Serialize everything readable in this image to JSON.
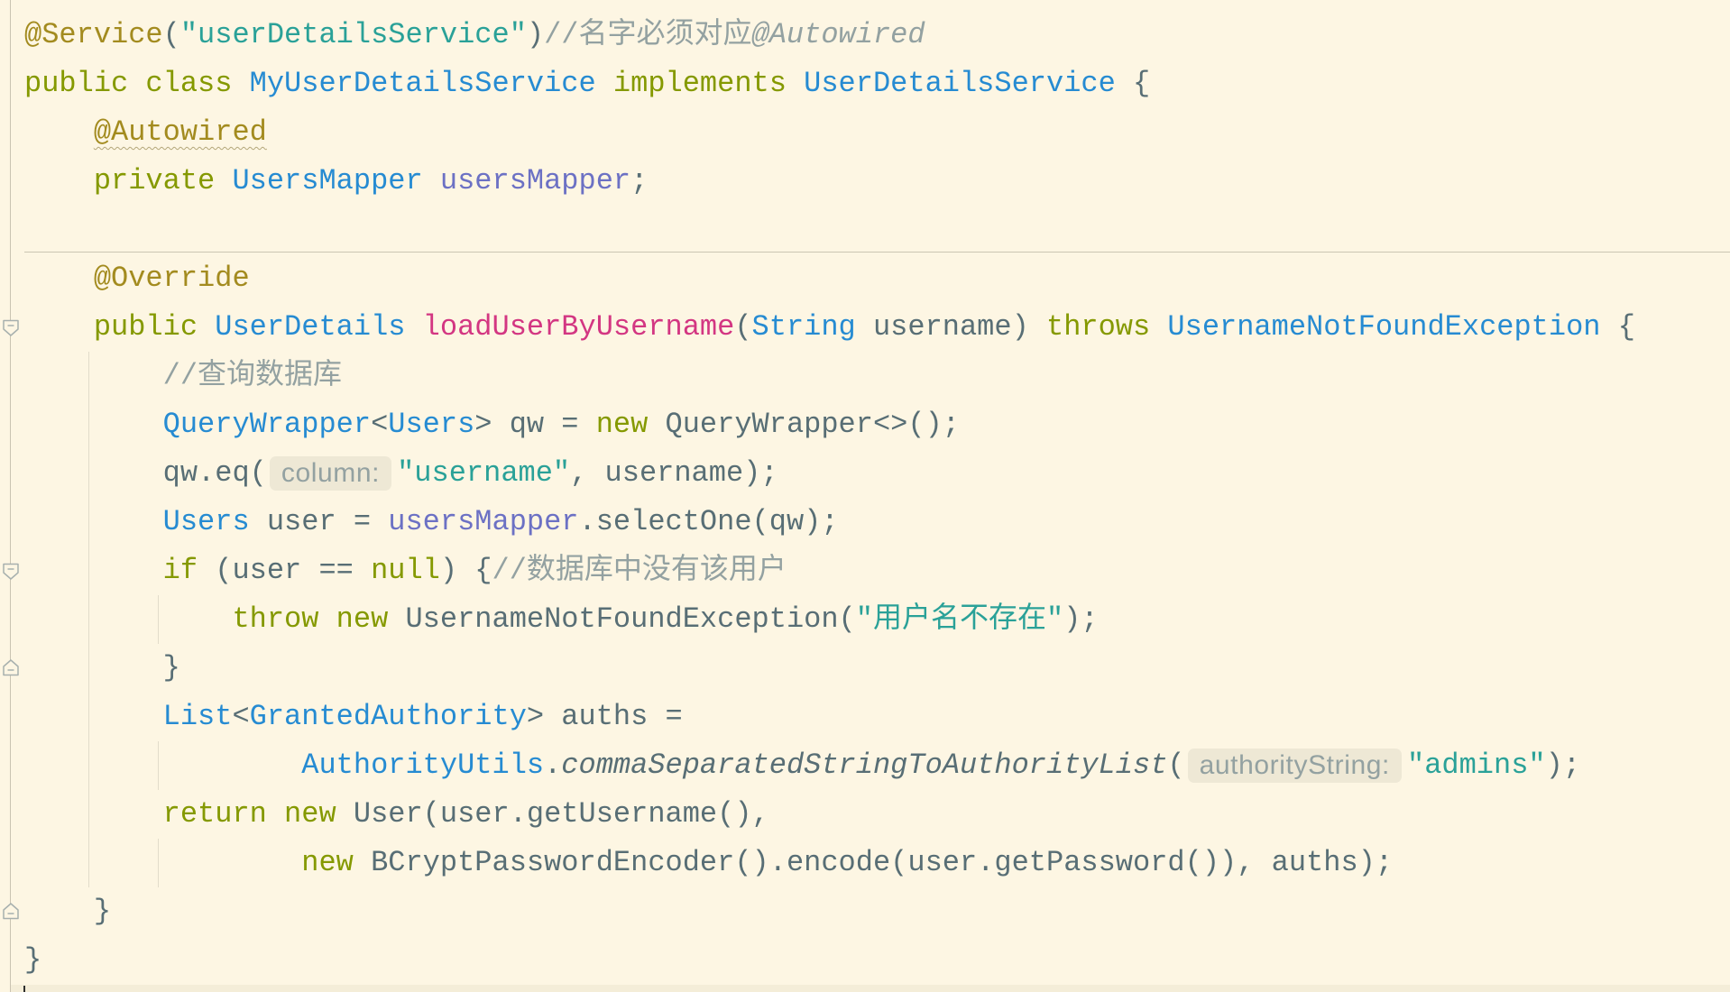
{
  "theme": {
    "background": "#FDF6E3",
    "text": "#586E75",
    "keyword": "#859900",
    "annotation": "#A38B1F",
    "string": "#2AA198",
    "comment": "#93A1A1",
    "type": "#268BD2",
    "field": "#6C71C4",
    "method": "#D33682",
    "hint_background": "#EEE8D5",
    "hint_text": "#93A1A1",
    "warning_underline": "#B3A77A"
  },
  "editor": {
    "lines": [
      {
        "tokens": [
          {
            "t": "@Service",
            "k": "annotation"
          },
          {
            "t": "(",
            "k": "text"
          },
          {
            "t": "\"userDetailsService\"",
            "k": "string"
          },
          {
            "t": ")",
            "k": "text"
          },
          {
            "t": "//名字必须对应",
            "k": "comment"
          },
          {
            "t": "@Autowired",
            "k": "comment-tag"
          }
        ]
      },
      {
        "tokens": [
          {
            "t": "public class ",
            "k": "keyword"
          },
          {
            "t": "MyUserDetailsService",
            "k": "type"
          },
          {
            "t": " implements ",
            "k": "keyword"
          },
          {
            "t": "UserDetailsService",
            "k": "type"
          },
          {
            "t": " {",
            "k": "text"
          }
        ]
      },
      {
        "tokens": [
          {
            "t": "    ",
            "k": "text"
          },
          {
            "t": "@Autowired",
            "k": "annotation-warning"
          }
        ]
      },
      {
        "tokens": [
          {
            "t": "    ",
            "k": "text"
          },
          {
            "t": "private ",
            "k": "keyword"
          },
          {
            "t": "UsersMapper",
            "k": "type"
          },
          {
            "t": " ",
            "k": "text"
          },
          {
            "t": "usersMapper",
            "k": "field"
          },
          {
            "t": ";",
            "k": "text"
          }
        ]
      },
      {
        "tokens": []
      },
      {
        "tokens": [
          {
            "t": "    ",
            "k": "text"
          },
          {
            "t": "@Override",
            "k": "annotation"
          }
        ]
      },
      {
        "gutter_icon": "fold-start-icon",
        "tokens": [
          {
            "t": "    ",
            "k": "text"
          },
          {
            "t": "public ",
            "k": "keyword"
          },
          {
            "t": "UserDetails",
            "k": "type"
          },
          {
            "t": " ",
            "k": "text"
          },
          {
            "t": "loadUserByUsername",
            "k": "method"
          },
          {
            "t": "(",
            "k": "text"
          },
          {
            "t": "String",
            "k": "type"
          },
          {
            "t": " username) ",
            "k": "text"
          },
          {
            "t": "throws ",
            "k": "keyword"
          },
          {
            "t": "UsernameNotFoundException",
            "k": "type"
          },
          {
            "t": " {",
            "k": "text"
          }
        ]
      },
      {
        "tokens": [
          {
            "t": "        ",
            "k": "text"
          },
          {
            "t": "//查询数据库",
            "k": "comment"
          }
        ]
      },
      {
        "tokens": [
          {
            "t": "        ",
            "k": "text"
          },
          {
            "t": "QueryWrapper",
            "k": "type"
          },
          {
            "t": "<",
            "k": "text"
          },
          {
            "t": "Users",
            "k": "type"
          },
          {
            "t": "> qw = ",
            "k": "text"
          },
          {
            "t": "new ",
            "k": "keyword"
          },
          {
            "t": "QueryWrapper<>();",
            "k": "text"
          }
        ]
      },
      {
        "tokens": [
          {
            "t": "        qw.eq(",
            "k": "text"
          },
          {
            "t": "column:",
            "k": "hint"
          },
          {
            "t": "\"username\"",
            "k": "string"
          },
          {
            "t": ", username);",
            "k": "text"
          }
        ]
      },
      {
        "tokens": [
          {
            "t": "        ",
            "k": "text"
          },
          {
            "t": "Users",
            "k": "type"
          },
          {
            "t": " user = ",
            "k": "text"
          },
          {
            "t": "usersMapper",
            "k": "field"
          },
          {
            "t": ".selectOne(qw);",
            "k": "text"
          }
        ]
      },
      {
        "gutter_icon": "fold-start-icon",
        "tokens": [
          {
            "t": "        ",
            "k": "text"
          },
          {
            "t": "if",
            "k": "keyword"
          },
          {
            "t": " (user == ",
            "k": "text"
          },
          {
            "t": "null",
            "k": "keyword"
          },
          {
            "t": ") {",
            "k": "text"
          },
          {
            "t": "//数据库中没有该用户",
            "k": "comment"
          }
        ]
      },
      {
        "tokens": [
          {
            "t": "            ",
            "k": "text"
          },
          {
            "t": "throw new ",
            "k": "keyword"
          },
          {
            "t": "UsernameNotFoundException(",
            "k": "text"
          },
          {
            "t": "\"用户名不存在\"",
            "k": "string"
          },
          {
            "t": ");",
            "k": "text"
          }
        ]
      },
      {
        "gutter_icon": "fold-end-icon",
        "tokens": [
          {
            "t": "        }",
            "k": "text"
          }
        ]
      },
      {
        "tokens": [
          {
            "t": "        ",
            "k": "text"
          },
          {
            "t": "List",
            "k": "type"
          },
          {
            "t": "<",
            "k": "text"
          },
          {
            "t": "GrantedAuthority",
            "k": "type"
          },
          {
            "t": "> auths =",
            "k": "text"
          }
        ]
      },
      {
        "tokens": [
          {
            "t": "                ",
            "k": "text"
          },
          {
            "t": "AuthorityUtils",
            "k": "type"
          },
          {
            "t": ".",
            "k": "text"
          },
          {
            "t": "commaSeparatedStringToAuthorityList",
            "k": "static-method"
          },
          {
            "t": "(",
            "k": "text"
          },
          {
            "t": "authorityString:",
            "k": "hint"
          },
          {
            "t": "\"admins\"",
            "k": "string"
          },
          {
            "t": ");",
            "k": "text"
          }
        ]
      },
      {
        "tokens": [
          {
            "t": "        ",
            "k": "text"
          },
          {
            "t": "return new ",
            "k": "keyword"
          },
          {
            "t": "User(user.getUsername(),",
            "k": "text"
          }
        ]
      },
      {
        "tokens": [
          {
            "t": "                ",
            "k": "text"
          },
          {
            "t": "new ",
            "k": "keyword"
          },
          {
            "t": "BCryptPasswordEncoder().encode(user.getPassword()), auths);",
            "k": "text"
          }
        ]
      },
      {
        "gutter_icon": "fold-end-icon",
        "tokens": [
          {
            "t": "    }",
            "k": "text"
          }
        ]
      },
      {
        "tokens": [
          {
            "t": "}",
            "k": "text"
          }
        ]
      }
    ]
  }
}
